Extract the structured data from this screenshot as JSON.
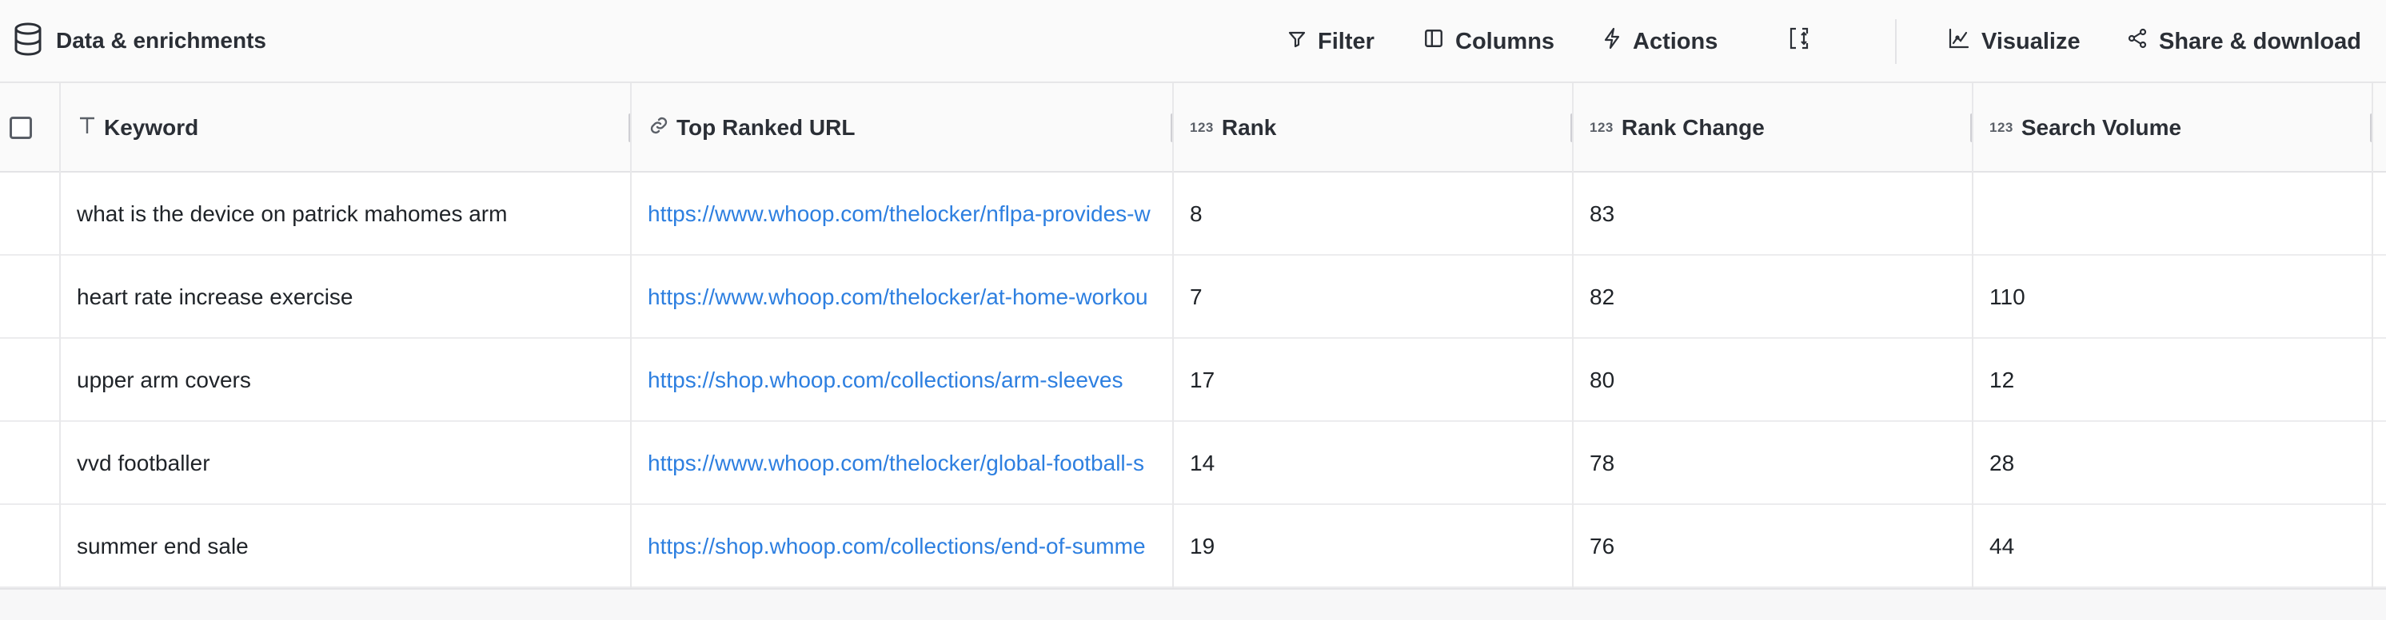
{
  "toolbar": {
    "title": "Data & enrichments",
    "filter_label": "Filter",
    "columns_label": "Columns",
    "actions_label": "Actions",
    "visualize_label": "Visualize",
    "share_label": "Share & download"
  },
  "table": {
    "number_type_icon": "123",
    "columns": [
      {
        "label": "Keyword",
        "icon": "text-type-icon"
      },
      {
        "label": "Top Ranked URL",
        "icon": "link-icon"
      },
      {
        "label": "Rank",
        "icon": "number-type-icon"
      },
      {
        "label": "Rank Change",
        "icon": "number-type-icon"
      },
      {
        "label": "Search Volume",
        "icon": "number-type-icon"
      }
    ],
    "rows": [
      {
        "keyword": "what is the device on patrick mahomes arm",
        "url": "https://www.whoop.com/thelocker/nflpa-provides-w",
        "rank": "8",
        "rank_change": "83",
        "search_volume": ""
      },
      {
        "keyword": "heart rate increase exercise",
        "url": "https://www.whoop.com/thelocker/at-home-workou",
        "rank": "7",
        "rank_change": "82",
        "search_volume": "110"
      },
      {
        "keyword": "upper arm covers",
        "url": "https://shop.whoop.com/collections/arm-sleeves",
        "rank": "17",
        "rank_change": "80",
        "search_volume": "12"
      },
      {
        "keyword": "vvd footballer",
        "url": "https://www.whoop.com/thelocker/global-football-s",
        "rank": "14",
        "rank_change": "78",
        "search_volume": "28"
      },
      {
        "keyword": "summer end sale",
        "url": "https://shop.whoop.com/collections/end-of-summe",
        "rank": "19",
        "rank_change": "76",
        "search_volume": "44"
      }
    ]
  },
  "colors": {
    "link": "#2d7fe0",
    "text": "#1f2328",
    "header_bg": "#fafafa",
    "border": "#e3e3e6"
  }
}
